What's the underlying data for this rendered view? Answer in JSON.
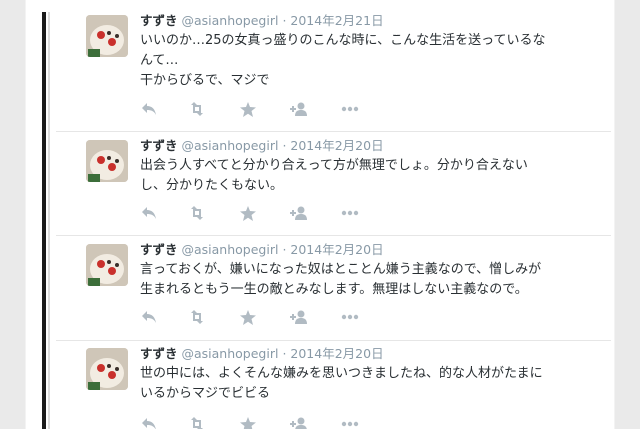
{
  "tweets": [
    {
      "name": "すずき",
      "handle": "@asianhopegirl",
      "separator": "·",
      "date": "2014年2月21日",
      "lines": [
        "いいのか…25の女真っ盛りのこんな時に、こんな生活を送っているな",
        "んて…",
        "干からびるで、マジで"
      ]
    },
    {
      "name": "すずき",
      "handle": "@asianhopegirl",
      "separator": "·",
      "date": "2014年2月20日",
      "lines": [
        "出会う人すべてと分かり合えって方が無理でしょ。分かり合えない",
        "し、分かりたくもない。"
      ]
    },
    {
      "name": "すずき",
      "handle": "@asianhopegirl",
      "separator": "·",
      "date": "2014年2月20日",
      "lines": [
        "言っておくが、嫌いになった奴はとことん嫌う主義なので、憎しみが",
        "生まれるともう一生の敵とみなします。無理はしない主義なので。"
      ]
    },
    {
      "name": "すずき",
      "handle": "@asianhopegirl",
      "separator": "·",
      "date": "2014年2月20日",
      "lines": [
        "世の中には、よくそんな嫌みを思いつきましたね、的な人材がたまに",
        "いるからマジでビビる"
      ]
    }
  ],
  "actions": [
    "reply-icon",
    "retweet-icon",
    "favorite-icon",
    "follow-icon",
    "more-icon"
  ],
  "colors": {
    "name": "#292f33",
    "meta": "#8899a6",
    "icon": "#b1bbc3",
    "divider": "#e6e6e6"
  }
}
